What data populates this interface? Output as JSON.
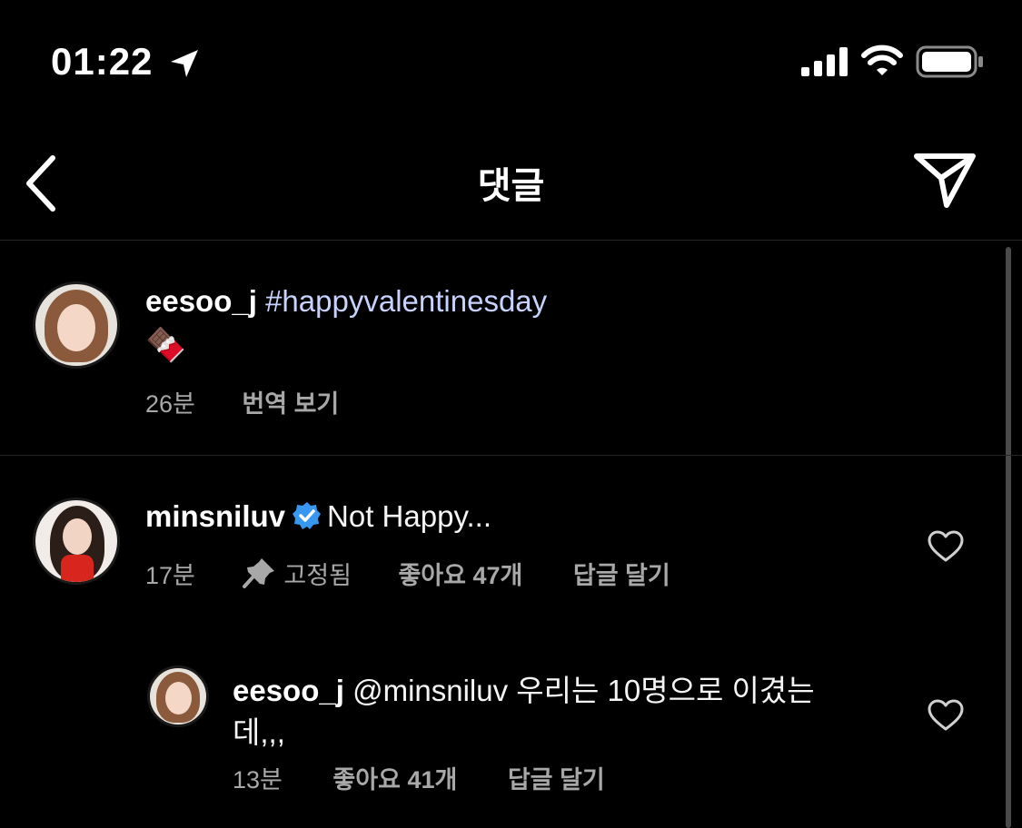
{
  "status_bar": {
    "time": "01:22",
    "icons": [
      "location-arrow-icon",
      "cellular-signal-icon",
      "wifi-icon",
      "battery-icon"
    ]
  },
  "nav": {
    "title": "댓글",
    "back_icon": "chevron-left-icon",
    "share_icon": "paper-plane-icon"
  },
  "caption": {
    "username": "eesoo_j",
    "hashtag": "#happyvalentinesday",
    "emoji": "🍫",
    "time": "26분",
    "translate": "번역 보기"
  },
  "comments": [
    {
      "username": "minsniluv",
      "verified": true,
      "text": "Not Happy...",
      "time": "17분",
      "pinned": "고정됨",
      "likes_prefix": "좋아요",
      "likes_count": "47개",
      "reply": "답글 달기"
    },
    {
      "username": "eesoo_j",
      "mention": "@minsniluv",
      "text_line1": "우리는 10명으로 이겼는",
      "text_line2": "데,,,",
      "time": "13분",
      "likes_prefix": "좋아요",
      "likes_count": "41개",
      "reply": "답글 달기"
    }
  ],
  "colors": {
    "background": "#000000",
    "text": "#f5f5f5",
    "muted": "#a8a8a8",
    "hashtag": "#c7d2ff",
    "verified": "#3897f0",
    "divider": "#262626"
  }
}
